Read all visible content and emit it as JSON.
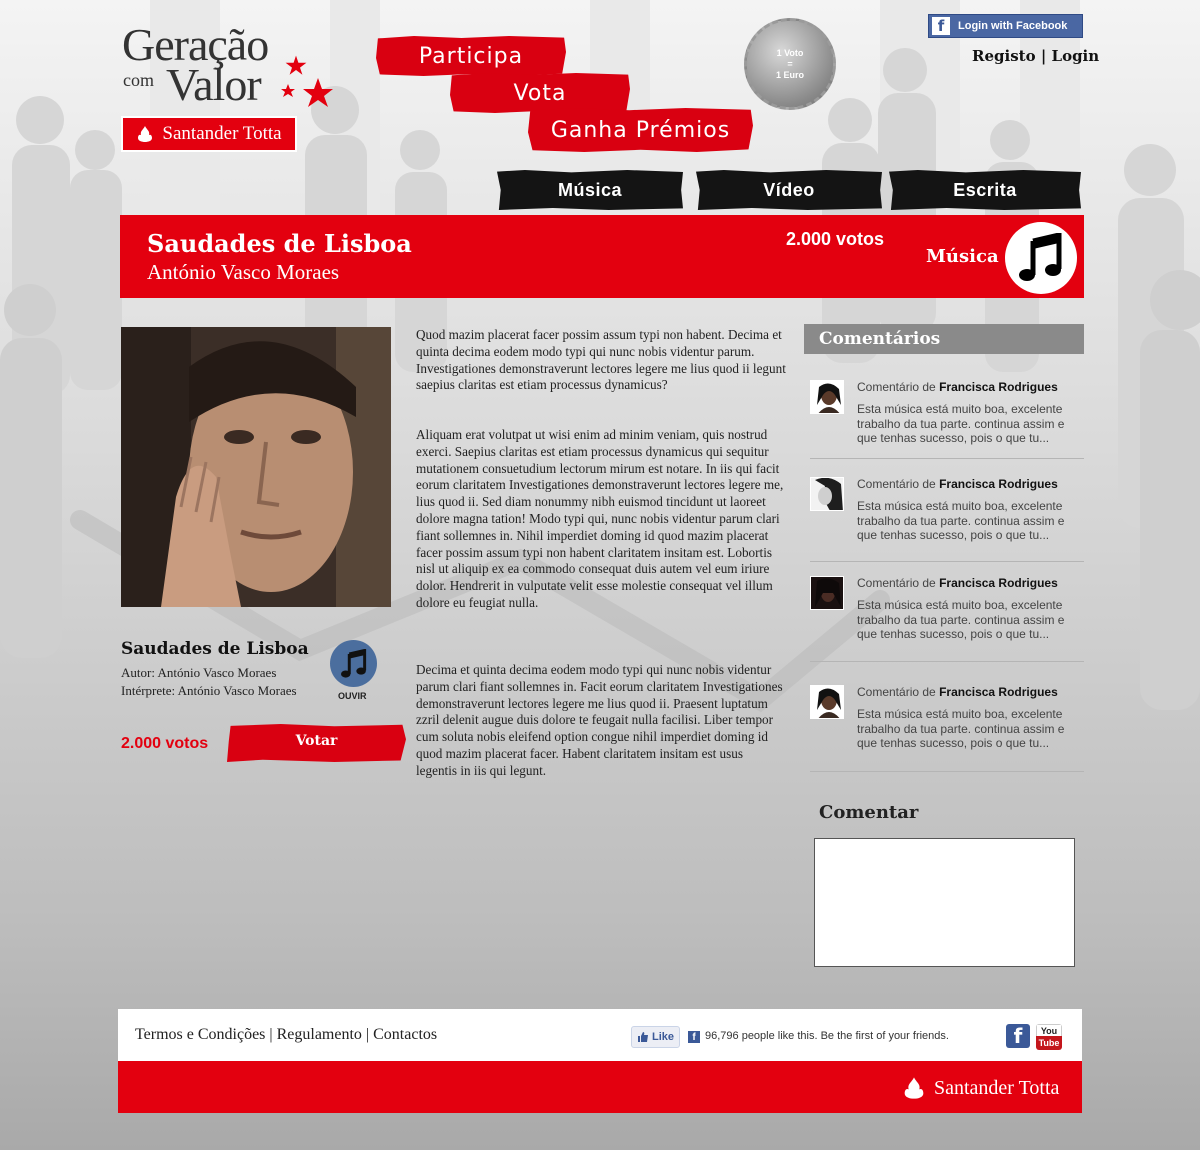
{
  "logo": {
    "line1": "Geração",
    "com": "com",
    "line2": "Valor",
    "sponsor": "Santander Totta"
  },
  "tagline": [
    "Participa",
    "Vota",
    "Ganha Prémios"
  ],
  "seal": {
    "line1": "1 Voto",
    "line2": "=",
    "line3": "1 Euro"
  },
  "header": {
    "facebook_login": "Login with Facebook",
    "register": "Registo",
    "separator": "|",
    "login": "Login"
  },
  "nav": {
    "musica": "Música",
    "video": "Vídeo",
    "escrita": "Escrita"
  },
  "banner": {
    "title": "Saudades de Lisboa",
    "author": "António Vasco Moraes",
    "votes": "2.000 votos",
    "category": "Música"
  },
  "song": {
    "title": "Saudades de Lisboa",
    "author": "Autor: António Vasco Moraes",
    "performer": "Intérprete: António Vasco Moraes",
    "listen": "OUVIR",
    "votes": "2.000 votos",
    "vote_button": "Votar"
  },
  "description": [
    "Quod mazim placerat facer possim assum typi non habent. Decima et quinta decima eodem modo typi qui nunc nobis videntur parum. Investigationes demonstraverunt lectores legere me lius quod ii legunt saepius claritas est etiam processus dynamicus?",
    "Aliquam erat volutpat ut wisi enim ad minim veniam, quis nostrud exerci. Saepius claritas est etiam processus dynamicus qui sequitur mutationem consuetudium lectorum mirum est notare. In iis qui facit eorum claritatem Investigationes demonstraverunt lectores legere me, lius quod ii. Sed diam nonummy nibh euismod tincidunt ut laoreet dolore magna tation! Modo typi qui, nunc nobis videntur parum clari fiant sollemnes in. Nihil imperdiet doming id quod mazim placerat facer possim assum typi non habent claritatem insitam est. Lobortis nisl ut aliquip ex ea commodo consequat duis autem vel eum iriure dolor. Hendrerit in vulputate velit esse molestie consequat vel illum dolore eu feugiat nulla.",
    "Decima et quinta decima eodem modo typi qui nunc nobis videntur parum clari fiant sollemnes in. Facit eorum claritatem Investigationes demonstraverunt lectores legere me lius quod ii. Praesent luptatum zzril delenit augue duis dolore te feugait nulla facilisi. Liber tempor cum soluta nobis eleifend option congue nihil imperdiet doming id quod mazim placerat facer. Habent claritatem insitam est usus legentis in iis qui legunt."
  ],
  "comments": {
    "title": "Comentários",
    "items": [
      {
        "prefix": "Comentário de",
        "author": "Francisca Rodrigues",
        "text": "Esta música está muito boa, excelente trabalho da tua parte. continua assim e que tenhas sucesso, pois o que tu..."
      },
      {
        "prefix": "Comentário de",
        "author": "Francisca Rodrigues",
        "text": "Esta música está muito boa, excelente trabalho da tua parte. continua assim e que tenhas sucesso, pois o que tu..."
      },
      {
        "prefix": "Comentário de",
        "author": "Francisca Rodrigues",
        "text": "Esta música está muito boa, excelente trabalho da tua parte. continua assim e que tenhas sucesso, pois o que tu..."
      },
      {
        "prefix": "Comentário de",
        "author": "Francisca Rodrigues",
        "text": "Esta música está muito boa, excelente trabalho da tua parte. continua assim e que tenhas sucesso, pois o que tu..."
      }
    ],
    "form_title": "Comentar",
    "form_value": ""
  },
  "footer": {
    "terms": "Termos e Condições",
    "sep": "|",
    "rules": "Regulamento",
    "contacts": "Contactos",
    "like_button": "Like",
    "like_text": "96,796 people like this. Be the first of your friends.",
    "youtube_top": "You",
    "youtube_bottom": "Tube",
    "brand": "Santander Totta"
  },
  "colors": {
    "brand_red": "#e3000f",
    "nav_black": "#141414",
    "facebook_blue": "#3b5998",
    "listen_blue": "#4b6e9e"
  },
  "icons": [
    "star-icon",
    "flame-icon",
    "facebook-icon",
    "music-note-icon",
    "youtube-icon",
    "like-thumb-icon"
  ]
}
